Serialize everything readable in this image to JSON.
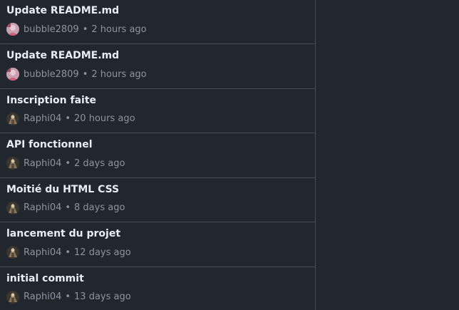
{
  "commits": [
    {
      "message": "Update README.md",
      "author": "bubble2809",
      "time": "2 hours ago",
      "avatar": "avatar-pink-icon"
    },
    {
      "message": "Update README.md",
      "author": "bubble2809",
      "time": "2 hours ago",
      "avatar": "avatar-pink-icon"
    },
    {
      "message": "Inscription faite",
      "author": "Raphi04",
      "time": "20 hours ago",
      "avatar": "avatar-brown-icon"
    },
    {
      "message": "API fonctionnel",
      "author": "Raphi04",
      "time": "2 days ago",
      "avatar": "avatar-brown-icon"
    },
    {
      "message": "Moitié du HTML CSS",
      "author": "Raphi04",
      "time": "8 days ago",
      "avatar": "avatar-brown-icon"
    },
    {
      "message": "lancement du projet",
      "author": "Raphi04",
      "time": "12 days ago",
      "avatar": "avatar-brown-icon"
    },
    {
      "message": "initial commit",
      "author": "Raphi04",
      "time": "13 days ago",
      "avatar": "avatar-brown-icon"
    }
  ],
  "meta_separator": "•",
  "colors": {
    "background": "#22272e",
    "border": "#444c56",
    "title": "#e6edf3",
    "muted": "#8b949e"
  }
}
